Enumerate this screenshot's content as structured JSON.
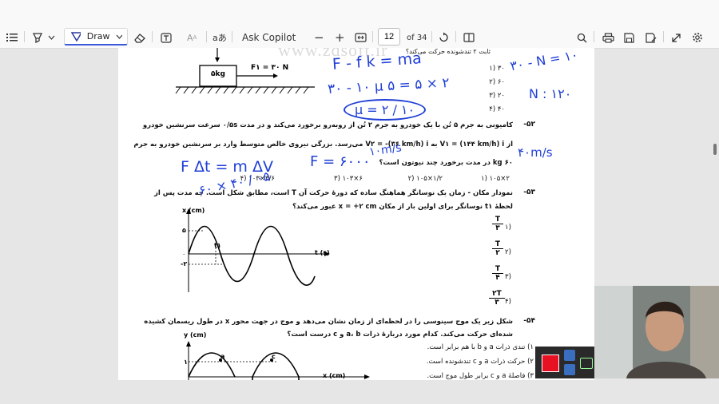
{
  "toolbar": {
    "draw_label": "Draw",
    "copilot_label": "Ask Copilot",
    "page_current": "12",
    "page_total": "of 34",
    "icons": [
      "list-icon",
      "highlighter-icon",
      "chevron-down-icon",
      "draw-pen-icon",
      "eraser-icon",
      "text-box-icon",
      "text-format-icon",
      "read-aloud-icon",
      "zoom-out-icon",
      "zoom-in-icon",
      "fit-width-icon",
      "rotate-icon",
      "page-view-icon",
      "search-icon",
      "print-icon",
      "save-icon",
      "save-as-icon",
      "fullscreen-icon",
      "settings-icon"
    ]
  },
  "watermark": "www.zdsoft.ir",
  "document": {
    "q51": {
      "header_fragment": "ثابت ۲ تندشونده حرکت می‌کند؟",
      "block_label": "۵kg",
      "force_label": "F۱ = ۳۰ N",
      "options": [
        "۳۰ (۱",
        "۶۰ (۲",
        "۲۰ (۳",
        "۴۰ (۴"
      ]
    },
    "q52": {
      "number": "-۵۲",
      "line1": "کامیونی به جرم ۵ تُن با یک خودرو به جرم ۲ تُن از روبه‌رو برخورد می‌کند و در مدت ۰/۵s سرعت سرنشین خودرو",
      "line2": "از V۱ = (۱۴۴ km/h) i به V۲ = -(۳۶ km/h) i می‌رسد. بزرگی نیروی خالص متوسط وارد بر سرنشین خودرو به جرم",
      "line3": "۶۰ kg در مدت برخورد چند نیوتون است؟",
      "options": [
        "۲×۱۰۵ (۱",
        "۱/۲×۱۰۵ (۲",
        "۶×۱۰۳ (۳",
        "۳/۶×۱۰۳ (۴"
      ]
    },
    "q53": {
      "number": "-۵۳",
      "line1": "نمودار مکان - زمان یک نوسانگر هماهنگ ساده که دورهٔ حرکت آن T است، مطابق شکل است. چه مدت پس از",
      "line2": "لحظهٔ t۱ نوسانگر برای اولین بار از مکان x = +۲ cm عبور می‌کند؟",
      "graph_ylabel": "x (cm)",
      "graph_xlabel": "t (s)",
      "graph_y_top": "۵",
      "graph_y_zero": "۰",
      "graph_y_neg": "-۲",
      "graph_t1": "t۱",
      "options_num": [
        "T",
        "T",
        "T",
        "۲T"
      ],
      "options_den": [
        "۳",
        "۲",
        "۴",
        "۳"
      ],
      "options_idx": [
        "(۱",
        "(۲",
        "(۳",
        "(۴"
      ]
    },
    "q54": {
      "number": "-۵۴",
      "line1": "شکل زیر یک موج سینوسی را در لحظه‌ای از زمان نشان می‌دهد و موج در جهت محور x در طول ریسمان کشیده",
      "line2": "شده‌ای حرکت می‌کند. کدام مورد دربارهٔ ذرات a، b و c درست است؟",
      "graph_ylabel": "y (cm)",
      "graph_xlabel": "x (cm)",
      "graph_y": "۱",
      "point_a": "a",
      "point_c": "c",
      "options": [
        "۱) تندی ذرات a و b با هم برابر است.",
        "۲) حرکت ذرات a و c تندشونده است.",
        "۳) فاصلهٔ a و c برابر طول موج است."
      ]
    }
  },
  "handwriting": {
    "h1": "F - f k = ma",
    "h2": "۳۰ - ۱۰ μ ۵ = ۵ × ۲",
    "h3": "μ = ۲ / ۱۰",
    "h4": "۳۰ - N = ۱۰",
    "h5": "N : ۱۲۰",
    "h6": "F Δt = m ΔV",
    "h7": "F = ۶۰۰۰",
    "h8": "۶۰ × ۴۰ / ۰۵",
    "h9": "۱۰m/s",
    "h10": "۴۰m/s"
  },
  "colors": {
    "ink_blue": "#1f3fd6",
    "accent": "#3b5bdb",
    "record_red": "#e81123"
  }
}
